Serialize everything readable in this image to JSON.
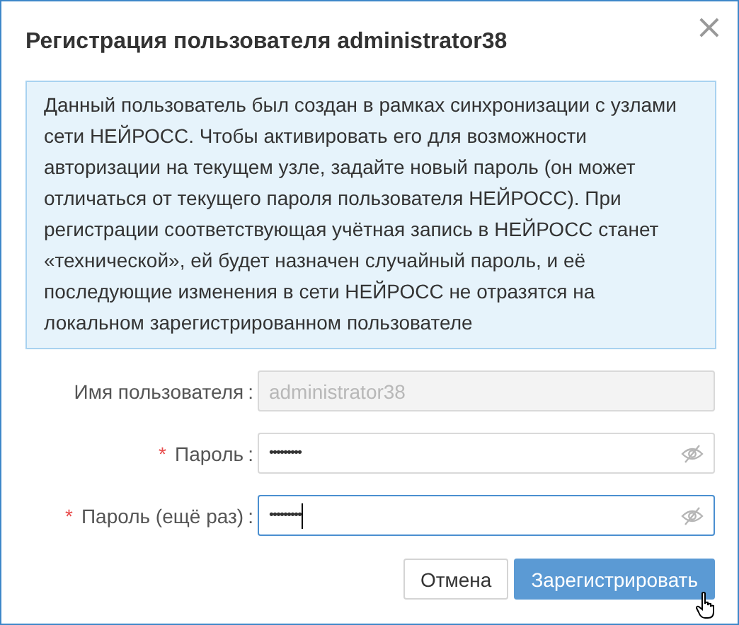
{
  "dialog": {
    "title": "Регистрация пользователя administrator38",
    "close": "×"
  },
  "notice": "Данный пользователь был создан в рамках синхронизации с узлами сети НЕЙРОСС. Чтобы активировать его для возможности авторизации на текущем узле, задайте новый пароль (он может отличаться от текущего пароля пользователя НЕЙРОСС). При регистрации соответствующая учётная запись в НЕЙРОСС станет «технической», ей будет назначен случайный пароль, и её последующие изменения в сети НЕЙРОСС не отразятся на локальном зарегистрированном пользователе",
  "required_mark": "*",
  "label_suffix": ":",
  "fields": [
    {
      "label": "Имя пользователя",
      "kind": "text",
      "value": "administrator38",
      "required": false,
      "disabled": true,
      "focused": false
    },
    {
      "label": "Пароль",
      "kind": "password",
      "value": "•••••••••",
      "required": true,
      "disabled": false,
      "focused": false
    },
    {
      "label": "Пароль (ещё раз)",
      "kind": "password",
      "value": "•••••••••",
      "required": true,
      "disabled": false,
      "focused": true
    }
  ],
  "buttons": [
    {
      "label": "Отмена",
      "kind": "secondary"
    },
    {
      "label": "Зарегистрировать",
      "kind": "primary"
    }
  ]
}
